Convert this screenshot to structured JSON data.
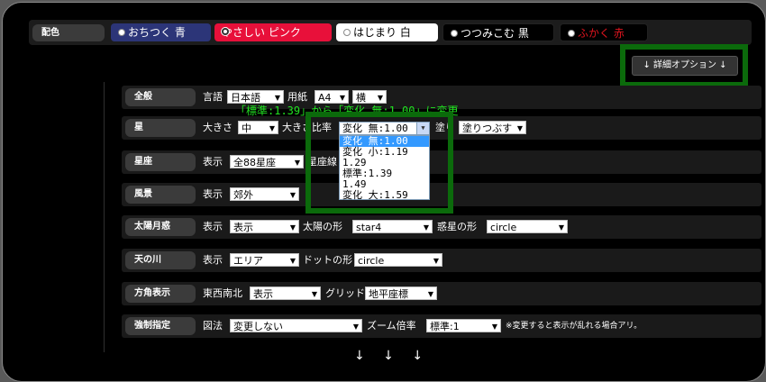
{
  "colorbar": {
    "label": "配色",
    "buttons": [
      {
        "label": "おちつく 青",
        "bg": "#2c3578",
        "fg": "#ffffff",
        "selected": false
      },
      {
        "label": "やさしい ピンク",
        "bg": "#e8103a",
        "fg": "#ffffff",
        "selected": true
      },
      {
        "label": "はじまり 白",
        "bg": "#ffffff",
        "fg": "#000000",
        "selected": false
      },
      {
        "label": "つつみこむ 黒",
        "bg": "#000000",
        "fg": "#ffffff",
        "selected": false
      },
      {
        "label": "ふかく 赤",
        "bg": "#000000",
        "fg": "#e0141e",
        "selected": false
      }
    ]
  },
  "detail_button": "↓ 詳細オプション ↓",
  "annotation": "「標準:1.39」から「変化 無:1.00」に変更",
  "rows": {
    "general": {
      "label": "全般",
      "lang_label": "言語",
      "lang": "日本語",
      "paper_label": "用紙",
      "paper": "A4",
      "orient": "横"
    },
    "star": {
      "label": "星",
      "size_label": "大きさ",
      "size": "中",
      "ratio_label": "大きさ比率",
      "ratio": "変化 無:1.00",
      "fill_label": "塗り",
      "fill": "塗りつぶす"
    },
    "constellation": {
      "label": "星座",
      "show_label": "表示",
      "show": "全88星座",
      "lines_label": "星座線"
    },
    "scenery": {
      "label": "風景",
      "show_label": "表示",
      "show": "郊外"
    },
    "sunmoon": {
      "label": "太陽月惑",
      "show_label": "表示",
      "show": "表示",
      "sun_label": "太陽の形",
      "sun": "star4",
      "planet_label": "惑星の形",
      "planet": "circle"
    },
    "milkyway": {
      "label": "天の川",
      "show_label": "表示",
      "show": "エリア",
      "dot_label": "ドットの形",
      "dot": "circle"
    },
    "direction": {
      "label": "方角表示",
      "ewsn_label": "東西南北",
      "ewsn": "表示",
      "grid_label": "グリッド",
      "grid": "地平座標"
    },
    "force": {
      "label": "強制指定",
      "proj_label": "図法",
      "proj": "変更しない",
      "zoom_label": "ズーム倍率",
      "zoom": "標準:1",
      "note": "※変更すると表示が乱れる場合アリ。"
    }
  },
  "ratio_options": [
    "変化 無:1.00",
    "変化 小:1.19",
    "1.29",
    "標準:1.39",
    "1.49",
    "変化 大:1.59"
  ],
  "ratio_selected_index": 0,
  "footer_arrows": "↓ ↓ ↓"
}
